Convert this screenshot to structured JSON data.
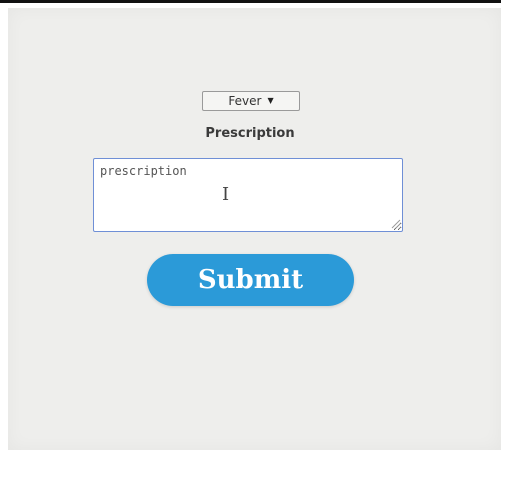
{
  "form": {
    "condition_select": {
      "selected": "Fever",
      "caret": "▼"
    },
    "prescription_label": "Prescription",
    "prescription_field": {
      "value": "prescription",
      "placeholder": "prescription"
    },
    "text_cursor_glyph": "I",
    "submit_label": "Submit"
  },
  "colors": {
    "submit_background": "#2b9ad8",
    "textarea_border": "#6f8fd6",
    "screen_background": "#eeeeec"
  },
  "icons": {
    "select_caret": "chevron-down-icon",
    "text_cursor": "text-cursor-icon",
    "textarea_resize": "resize-grip-icon"
  }
}
